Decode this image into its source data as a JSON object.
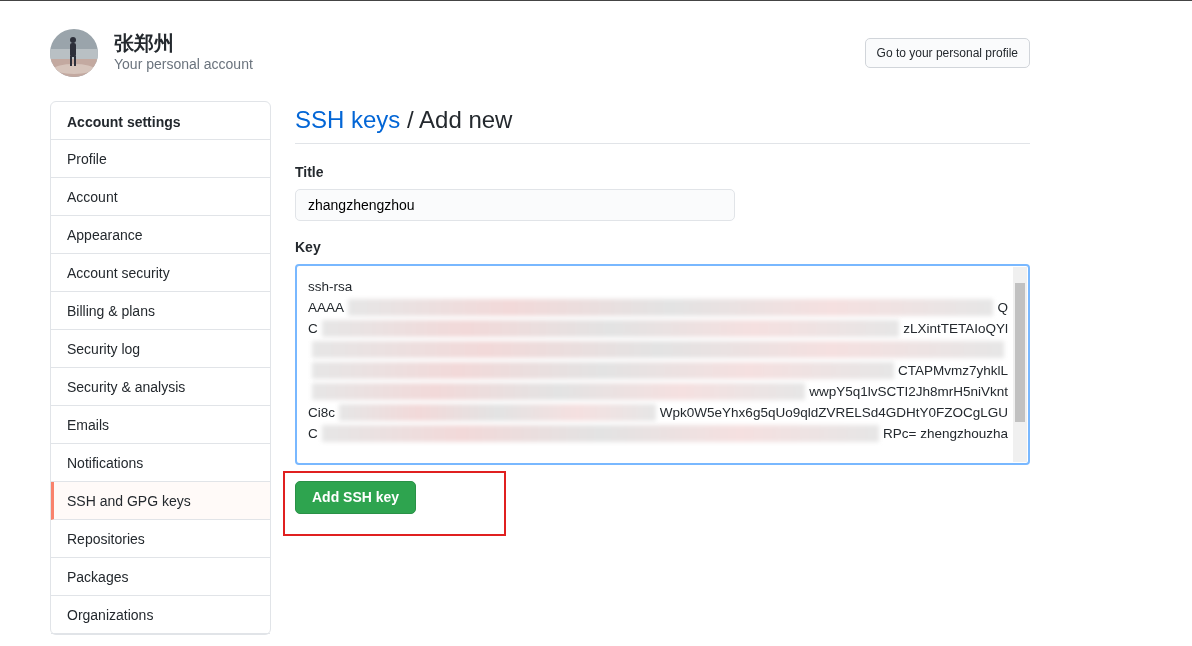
{
  "profile": {
    "name": "张郑州",
    "subtitle": "Your personal account",
    "profile_button": "Go to your personal profile"
  },
  "sidebar": {
    "heading": "Account settings",
    "items": [
      {
        "label": "Profile",
        "selected": false
      },
      {
        "label": "Account",
        "selected": false
      },
      {
        "label": "Appearance",
        "selected": false
      },
      {
        "label": "Account security",
        "selected": false
      },
      {
        "label": "Billing & plans",
        "selected": false
      },
      {
        "label": "Security log",
        "selected": false
      },
      {
        "label": "Security & analysis",
        "selected": false
      },
      {
        "label": "Emails",
        "selected": false
      },
      {
        "label": "Notifications",
        "selected": false
      },
      {
        "label": "SSH and GPG keys",
        "selected": true
      },
      {
        "label": "Repositories",
        "selected": false
      },
      {
        "label": "Packages",
        "selected": false
      },
      {
        "label": "Organizations",
        "selected": false
      }
    ]
  },
  "main": {
    "breadcrumb_link": "SSH keys",
    "heading": " / Add new",
    "title_field": {
      "label": "Title",
      "value": "zhangzhengzhou"
    },
    "key_field": {
      "label": "Key",
      "lines": [
        {
          "left": "ssh-rsa",
          "redacted": false
        },
        {
          "left": "AAAA",
          "redacted": true,
          "right": "Q"
        },
        {
          "left": "C",
          "redacted": true,
          "right": "zLXintTETAIoQYl"
        },
        {
          "redacted": true
        },
        {
          "redacted": true,
          "right": "CTAPMvmz7yhklL"
        },
        {
          "redacted": true,
          "right": "wwpY5q1lvSCTI2Jh8mrH5niVknt"
        },
        {
          "left": "Ci8c",
          "redacted": true,
          "right": "Wpk0W5eYhx6g5qUo9qldZVRELSd4GDHtY0FZOCgLGU"
        },
        {
          "left": "C",
          "redacted": true,
          "right": "RPc= zhengzhouzha"
        }
      ]
    },
    "submit": {
      "label": "Add SSH key",
      "highlighted": true
    }
  }
}
